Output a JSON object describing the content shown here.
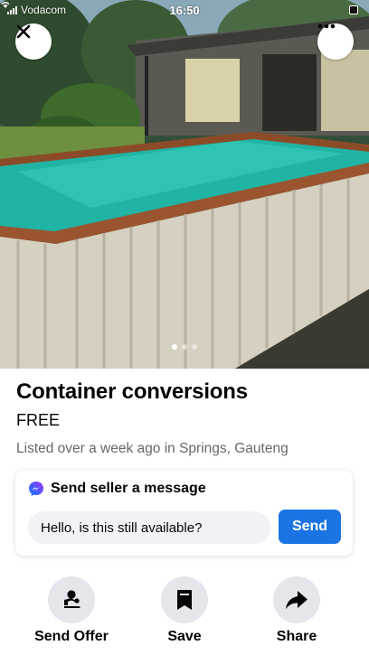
{
  "status_bar": {
    "carrier": "Vodacom",
    "time": "16:50"
  },
  "listing": {
    "title": "Container conversions",
    "price": "FREE",
    "meta": "Listed over a week ago in Springs, Gauteng"
  },
  "message": {
    "header": "Send seller a message",
    "input_value": "Hello, is this still available?",
    "send_label": "Send"
  },
  "actions": {
    "send_offer": "Send Offer",
    "save": "Save",
    "share": "Share"
  },
  "carousel": {
    "total": 3,
    "active_index": 0
  },
  "icons": {
    "close": "close-icon",
    "more": "more-horizontal-icon",
    "messenger": "messenger-icon",
    "send_offer": "person-offer-icon",
    "save": "bookmark-icon",
    "share": "share-arrow-icon"
  },
  "colors": {
    "accent": "#1b74e4",
    "secondary_text": "#65676b",
    "action_bg": "#e4e6eb",
    "input_bg": "#f0f2f5"
  }
}
